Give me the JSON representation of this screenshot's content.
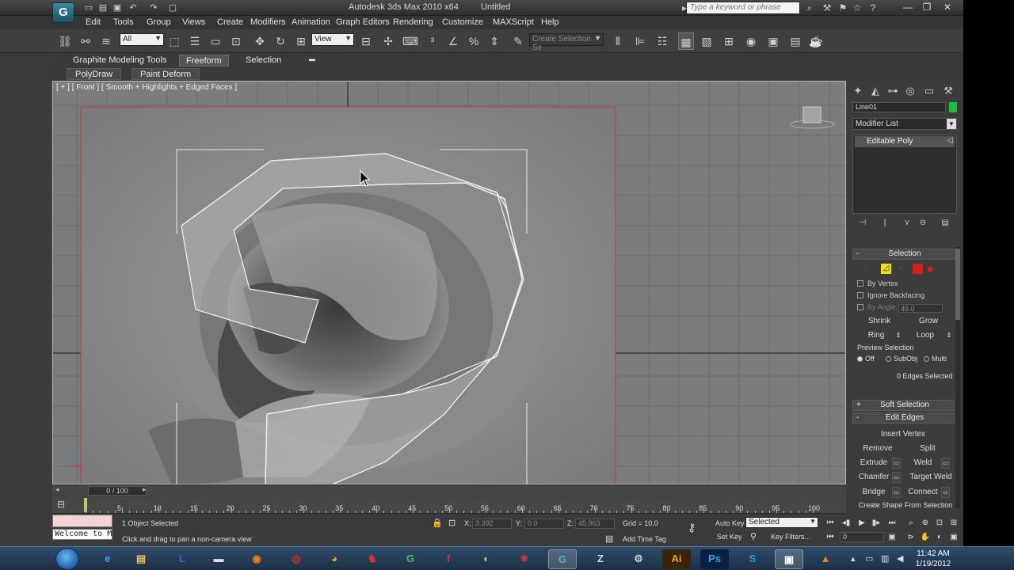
{
  "titlebar": {
    "app_logo": "G",
    "title": "Autodesk 3ds Max  2010 x64",
    "file": "Untitled",
    "search_placeholder": "Type a keyword or phrase",
    "minimize": "—",
    "restore": "❐",
    "close": "✕"
  },
  "menu": [
    "Edit",
    "Tools",
    "Group",
    "Views",
    "Create",
    "Modifiers",
    "Animation",
    "Graph Editors",
    "Rendering",
    "Customize",
    "MAXScript",
    "Help"
  ],
  "toolbar": {
    "selection_filter": "All",
    "ref_coord": "View",
    "named_selection": "Create Selection Se"
  },
  "ribbon": {
    "tabs": [
      "Graphite Modeling Tools",
      "Freeform",
      "Selection"
    ],
    "active_tab": "Freeform",
    "panels": [
      "PolyDraw",
      "Paint Deform"
    ]
  },
  "viewport": {
    "label": "[ + ] [ Front ] [ Smooth + Highlights + Edged Faces ]"
  },
  "command_panel": {
    "object_name": "Line01",
    "object_color": "#1bbf3a",
    "modifier_list": "Modifier List",
    "stack": [
      "Editable Poly"
    ],
    "selection": {
      "title": "Selection",
      "by_vertex": "By Vertex",
      "ignore_backfacing": "Ignore Backfacing",
      "by_angle": "By Angle:",
      "by_angle_value": "45.0",
      "shrink": "Shrink",
      "grow": "Grow",
      "ring": "Ring",
      "loop": "Loop",
      "preview_title": "Preview Selection",
      "preview_options": [
        "Off",
        "SubObj",
        "Multi"
      ],
      "preview_selected": "Off",
      "status": "0 Edges Selected"
    },
    "soft_selection": "Soft Selection",
    "edit_edges": {
      "title": "Edit Edges",
      "insert_vertex": "Insert Vertex",
      "remove": "Remove",
      "split": "Split",
      "extrude": "Extrude",
      "weld": "Weld",
      "chamfer": "Chamfer",
      "target_weld": "Target Weld",
      "bridge": "Bridge",
      "connect": "Connect",
      "create_shape": "Create Shape From Selection"
    }
  },
  "timeline": {
    "frame_display": "0 / 100",
    "ticks": [
      "5",
      "10",
      "15",
      "20",
      "25",
      "30",
      "35",
      "40",
      "45",
      "50",
      "55",
      "60",
      "65",
      "70",
      "75",
      "80",
      "85",
      "90",
      "95",
      "100"
    ]
  },
  "status": {
    "listener_text": "Welcome to M",
    "objects_selected": "1 Object Selected",
    "prompt": "Click and drag to pan a non-camera view",
    "x_label": "X:",
    "x_value": "3.392",
    "y_label": "Y:",
    "y_value": "0.0",
    "z_label": "Z:",
    "z_value": "45.963",
    "grid": "Grid = 10.0",
    "add_time_tag": "Add Time Tag",
    "auto_key": "Auto Key",
    "auto_key_mode": "Selected",
    "set_key": "Set Key",
    "key_filters": "Key Filters...",
    "current_frame": "0"
  },
  "taskbar": {
    "time": "11:42 AM",
    "date": "1/19/2012"
  }
}
